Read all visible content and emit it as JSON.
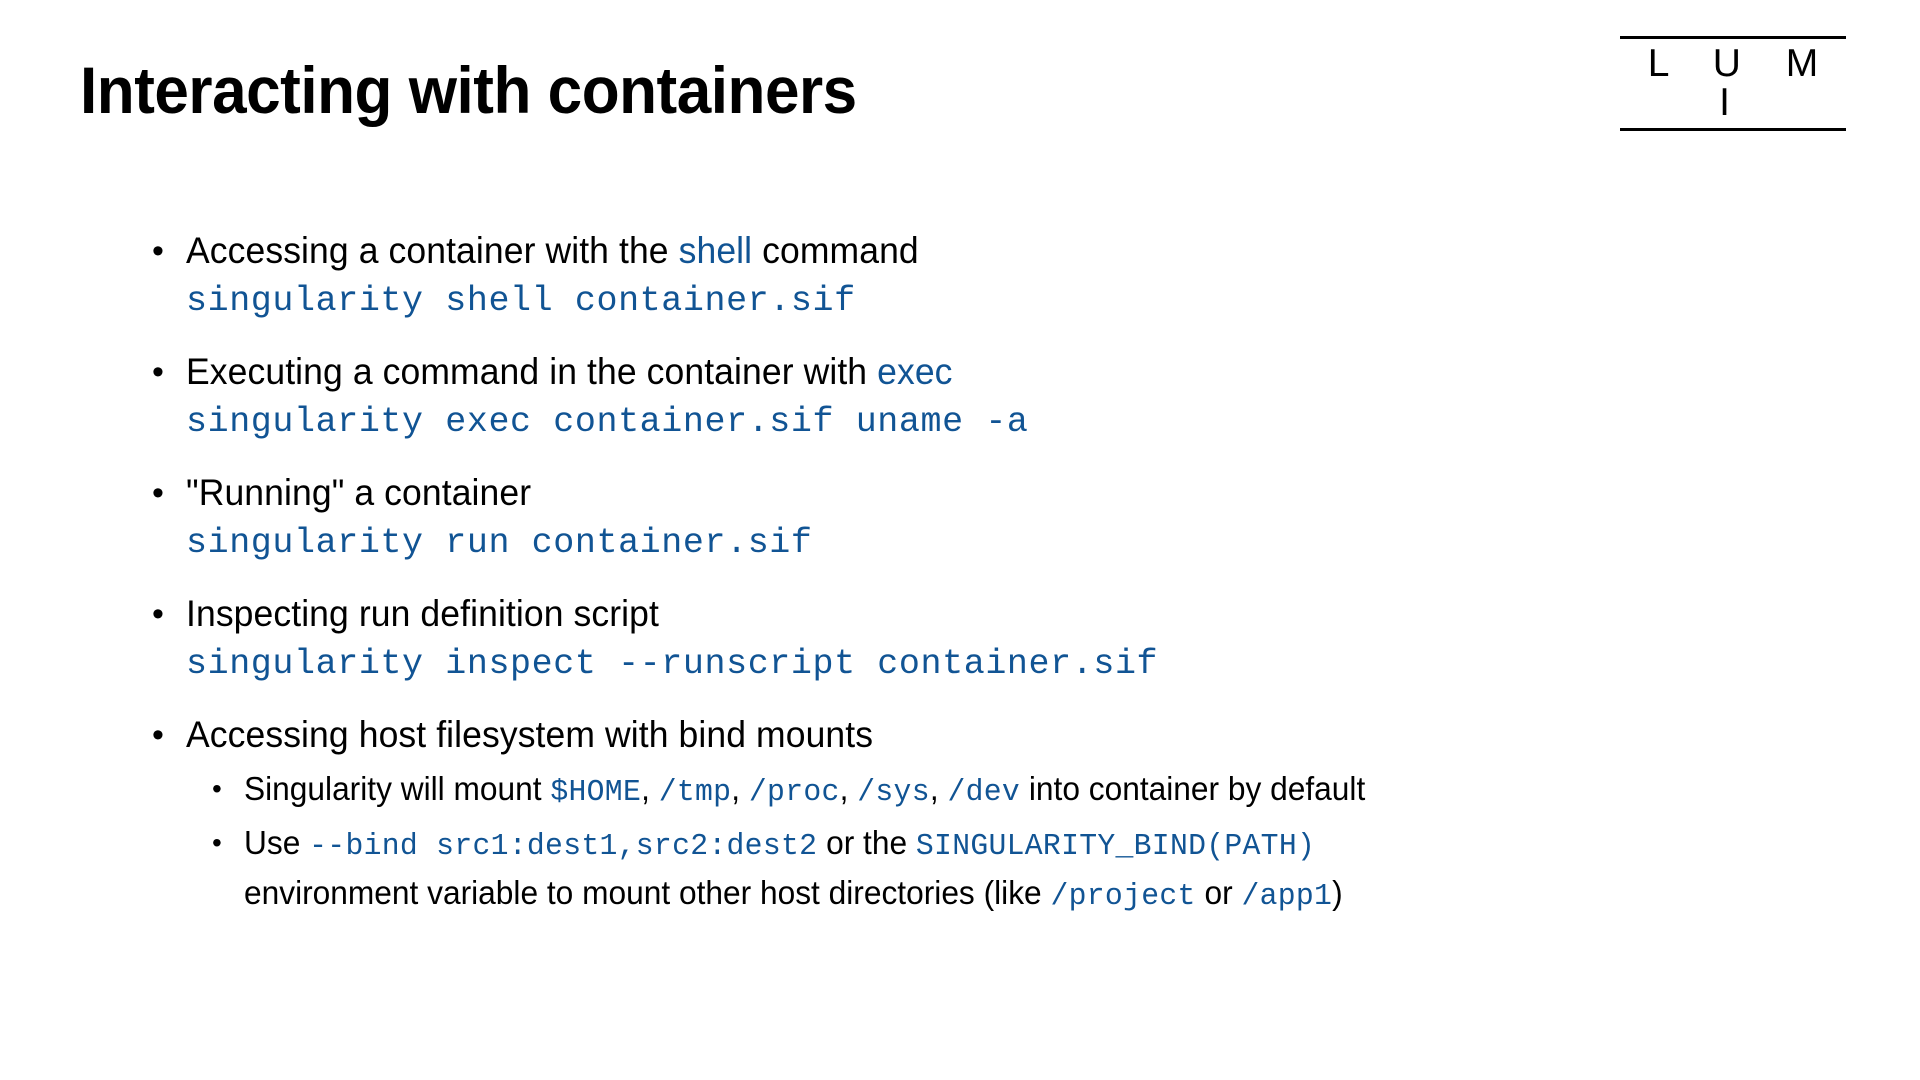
{
  "slide": {
    "title": "Interacting with containers",
    "logo": {
      "wordmark": "L U M I"
    },
    "accent_color": "#115494",
    "text_color": "#000000",
    "background_color": "#ffffff",
    "bullets": [
      {
        "prose_before": "Accessing a container with the ",
        "keyword": "shell",
        "prose_after": " command",
        "code": "singularity shell container.sif"
      },
      {
        "prose_before": "Executing a command in the container with ",
        "keyword": "exec",
        "prose_after": "",
        "code": "singularity exec container.sif uname -a"
      },
      {
        "prose_before": "\"Running\" a container",
        "keyword": "",
        "prose_after": "",
        "code": "singularity run container.sif"
      },
      {
        "prose_before": "Inspecting run definition script",
        "keyword": "",
        "prose_after": "",
        "code": "singularity inspect --runscript container.sif"
      },
      {
        "prose_before": "Accessing host filesystem with bind mounts",
        "keyword": "",
        "prose_after": "",
        "code": ""
      }
    ],
    "subbullets": {
      "mount_defaults": {
        "lead": "Singularity will mount ",
        "paths": [
          "$HOME",
          "/tmp",
          "/proc",
          "/sys",
          "/dev"
        ],
        "separator": ", ",
        "tail": " into container by default"
      },
      "bind_usage": {
        "lead": "Use ",
        "bind_flag": "--bind src1:dest1,src2:dest2",
        "middle": " or the ",
        "env_var": "SINGULARITY_BIND(PATH)",
        "continuation": "environment variable to mount other host directories (like ",
        "example_one": "/project",
        "or_text": " or ",
        "example_two": "/app1",
        "closing": ")"
      }
    }
  }
}
